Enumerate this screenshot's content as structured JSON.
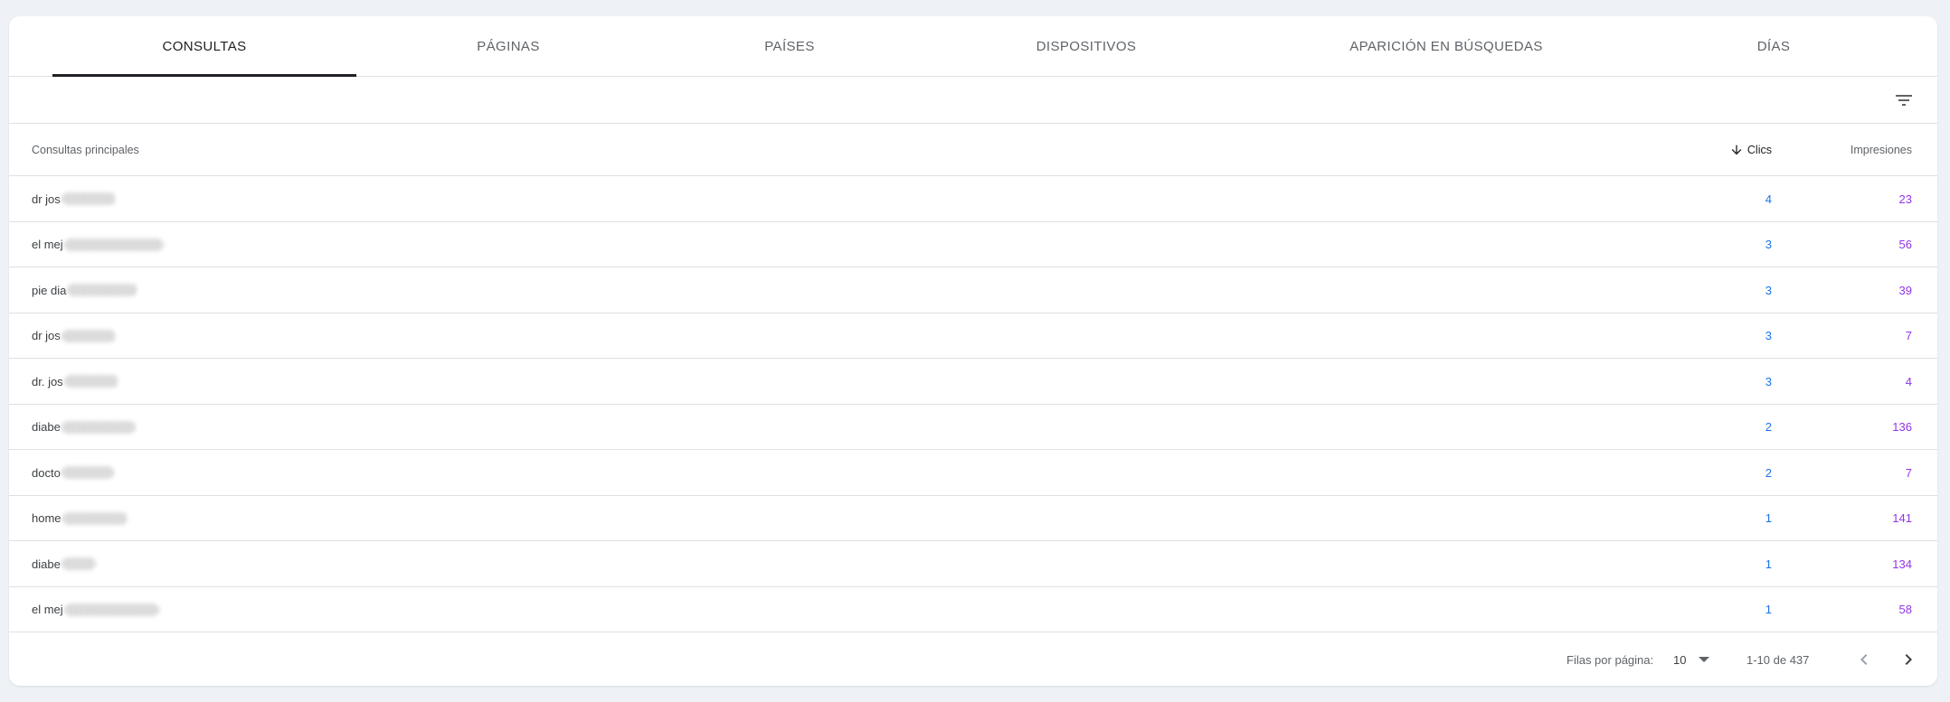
{
  "tabs": [
    {
      "label": "CONSULTAS",
      "active": true
    },
    {
      "label": "PÁGINAS",
      "active": false
    },
    {
      "label": "PAÍSES",
      "active": false
    },
    {
      "label": "DISPOSITIVOS",
      "active": false
    },
    {
      "label": "APARICIÓN EN BÚSQUEDAS",
      "active": false
    },
    {
      "label": "DÍAS",
      "active": false
    }
  ],
  "table": {
    "headers": {
      "query": "Consultas principales",
      "clicks": "Clics",
      "impressions": "Impresiones"
    },
    "sort_column": "clicks",
    "rows": [
      {
        "query": "dr jos",
        "clicks": "4",
        "impressions": "23"
      },
      {
        "query": "el mej",
        "clicks": "3",
        "impressions": "56"
      },
      {
        "query": "pie dia",
        "clicks": "3",
        "impressions": "39"
      },
      {
        "query": "dr jos",
        "clicks": "3",
        "impressions": "7"
      },
      {
        "query": "dr. jos",
        "clicks": "3",
        "impressions": "4"
      },
      {
        "query": "diabe",
        "clicks": "2",
        "impressions": "136"
      },
      {
        "query": "docto",
        "clicks": "2",
        "impressions": "7"
      },
      {
        "query": "home",
        "clicks": "1",
        "impressions": "141"
      },
      {
        "query": "diabe",
        "clicks": "1",
        "impressions": "134"
      },
      {
        "query": "el mej",
        "clicks": "1",
        "impressions": "58"
      }
    ]
  },
  "pagination": {
    "rows_per_page_label": "Filas por página:",
    "rows_per_page": "10",
    "range": "1-10 de 437"
  },
  "colors": {
    "clicks": "#1a73e8",
    "impressions": "#9334e6",
    "background": "#eef2f7"
  },
  "icons": [
    "filter-icon",
    "arrow-down-icon",
    "dropdown-caret-icon",
    "chevron-left-icon",
    "chevron-right-icon"
  ]
}
